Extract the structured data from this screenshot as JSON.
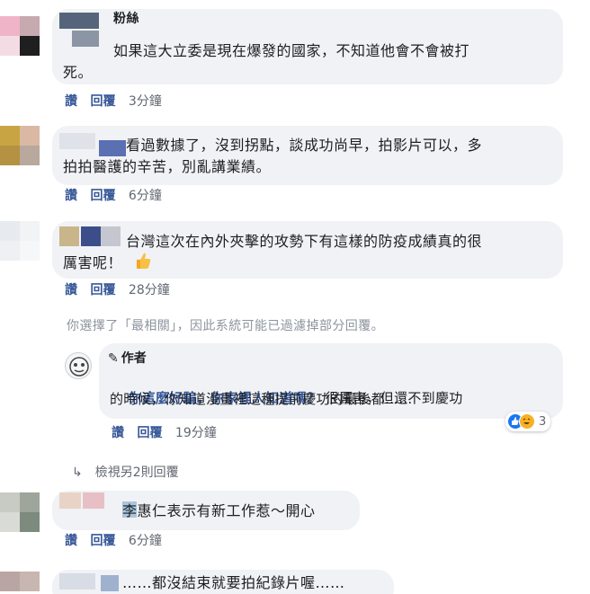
{
  "comments": [
    {
      "name": "粉絲",
      "lines": [
        "如果這大立委是現在爆發的國家，不知道他會不會被打",
        "死。"
      ],
      "like": "讚",
      "reply": "回覆",
      "time": "3分鐘"
    },
    {
      "lines": [
        "看過數據了，沒到拐點，談成功尚早，拍影片可以，多",
        "拍拍醫護的辛苦，別亂講業績。"
      ],
      "like": "讚",
      "reply": "回覆",
      "time": "6分鐘"
    },
    {
      "lines": [
        "台灣這次在內外夾擊的攻勢下有這樣的防疫成績真的很",
        "厲害呢！"
      ],
      "like": "讚",
      "reply": "回覆",
      "time": "28分鐘"
    }
  ],
  "filter_note": "你選擇了「最相關」，因此系統可能已過濾掉部分回覆。",
  "author_reply": {
    "tag": "作者",
    "bold": "你這麼好騙，你家裡人知道嗎？",
    "line1_rest": "很厲害，但還不到慶功",
    "line2": "的時候，你知道漫畫裡這種提前慶功的最後都……",
    "like": "讚",
    "reply": "回覆",
    "time": "19分鐘",
    "reaction_count": "3"
  },
  "more_replies": "檢視另2則回覆",
  "comment4": {
    "text": "李惠仁表示有新工作惹～開心",
    "like": "讚",
    "reply": "回覆",
    "time": "6分鐘"
  },
  "comment5": {
    "text": "……都沒結束就要拍紀錄片喔……"
  }
}
